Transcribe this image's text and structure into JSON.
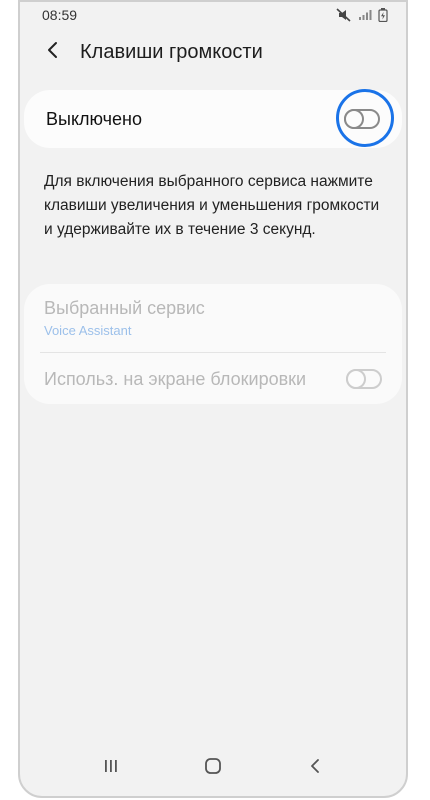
{
  "status_bar": {
    "time": "08:59",
    "icons": [
      "mute-icon",
      "signal-icon",
      "battery-icon"
    ]
  },
  "header": {
    "back_icon": "chevron-left-icon",
    "title": "Клавиши громкости"
  },
  "main_toggle": {
    "label": "Выключено",
    "state": "off",
    "highlight_color": "#1a73e8"
  },
  "description": "Для включения выбранного сервиса нажмите клавиши увеличения и уменьшения громкости и удерживайте их в течение 3 секунд.",
  "settings": {
    "selected_service": {
      "title": "Выбранный сервис",
      "value": "Voice Assistant"
    },
    "lock_screen": {
      "label": "Использ. на экране блокировки",
      "state": "off",
      "enabled": false
    }
  },
  "nav_bar": {
    "icons": [
      "recent-apps-icon",
      "home-icon",
      "back-icon"
    ]
  },
  "colors": {
    "accent": "#1a73e8",
    "background": "#f2f2f2",
    "disabled_text": "#b8b8b8",
    "disabled_link": "#9cc0ea"
  }
}
